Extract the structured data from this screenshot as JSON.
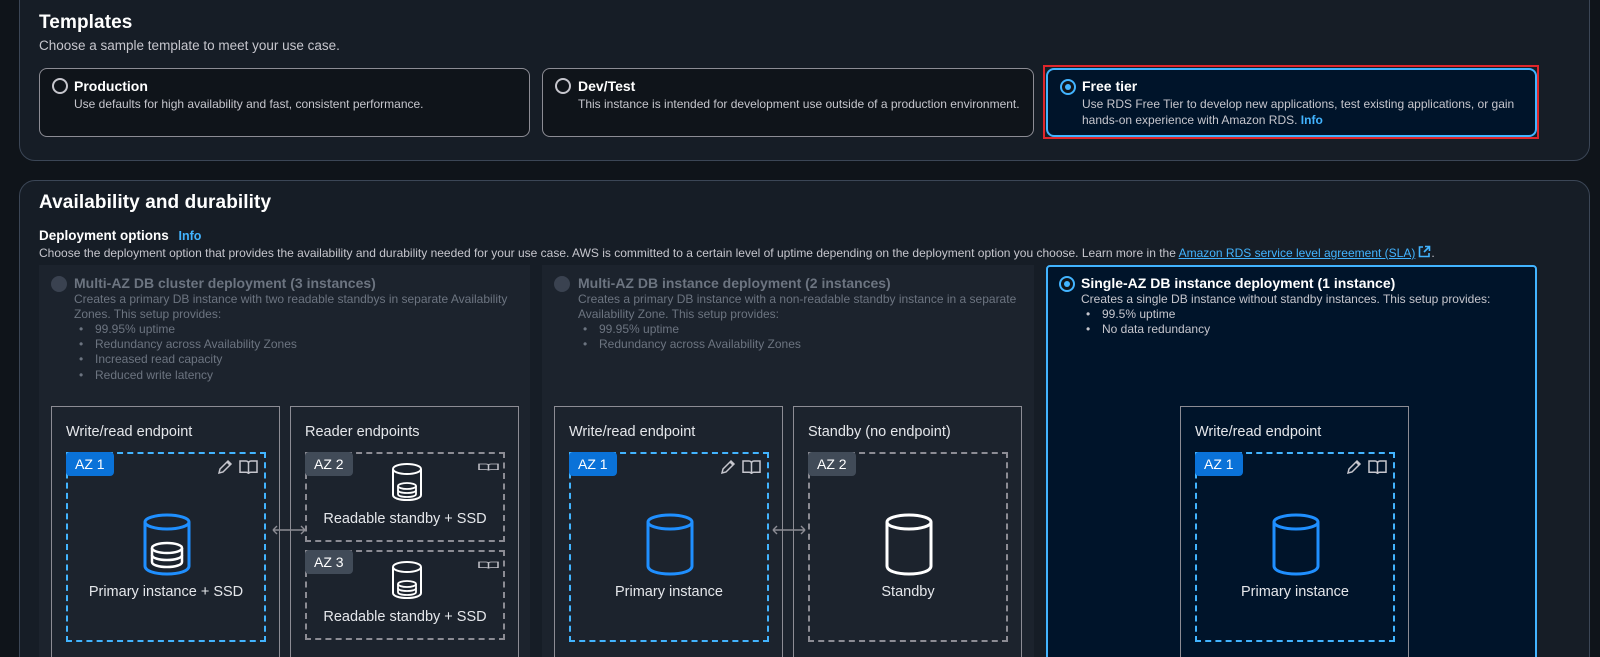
{
  "templates": {
    "title": "Templates",
    "subtitle": "Choose a sample template to meet your use case.",
    "options": [
      {
        "label": "Production",
        "desc": "Use defaults for high availability and fast, consistent performance.",
        "selected": false
      },
      {
        "label": "Dev/Test",
        "desc": "This instance is intended for development use outside of a production environment.",
        "selected": false
      },
      {
        "label": "Free tier",
        "desc": "Use RDS Free Tier to develop new applications, test existing applications, or gain hands-on experience with Amazon RDS.",
        "info": "Info",
        "selected": true
      }
    ]
  },
  "availability": {
    "title": "Availability and durability",
    "deployment_label": "Deployment options",
    "info": "Info",
    "desc": "Choose the deployment option that provides the availability and durability needed for your use case. AWS is committed to a certain level of uptime depending on the deployment option you choose. Learn more in the",
    "sla_link": "Amazon RDS service level agreement (SLA)",
    "desc_end": ".",
    "options": [
      {
        "label": "Multi-AZ DB cluster deployment (3 instances)",
        "desc": "Creates a primary DB instance with two readable standbys in separate Availability Zones. This setup provides:",
        "bullets": [
          "99.95% uptime",
          "Redundancy across Availability Zones",
          "Increased read capacity",
          "Reduced write latency"
        ],
        "selected": false,
        "boxes": [
          {
            "title": "Write/read endpoint",
            "azs": [
              {
                "tag": "AZ 1",
                "label": "Primary instance + SSD"
              }
            ]
          },
          {
            "title": "Reader endpoints",
            "azs": [
              {
                "tag": "AZ 2",
                "label": "Readable standby + SSD"
              },
              {
                "tag": "AZ 3",
                "label": "Readable standby + SSD"
              }
            ]
          }
        ]
      },
      {
        "label": "Multi-AZ DB instance deployment (2 instances)",
        "desc": "Creates a primary DB instance with a non-readable standby instance in a separate Availability Zone. This setup provides:",
        "bullets": [
          "99.95% uptime",
          "Redundancy across Availability Zones"
        ],
        "selected": false,
        "boxes": [
          {
            "title": "Write/read endpoint",
            "azs": [
              {
                "tag": "AZ 1",
                "label": "Primary instance"
              }
            ]
          },
          {
            "title": "Standby (no endpoint)",
            "azs": [
              {
                "tag": "AZ 2",
                "label": "Standby"
              }
            ]
          }
        ]
      },
      {
        "label": "Single-AZ DB instance deployment (1 instance)",
        "desc": "Creates a single DB instance without standby instances. This setup provides:",
        "bullets": [
          "99.5% uptime",
          "No data redundancy"
        ],
        "selected": true,
        "boxes": [
          {
            "title": "Write/read endpoint",
            "azs": [
              {
                "tag": "AZ 1",
                "label": "Primary instance"
              }
            ]
          }
        ]
      }
    ]
  },
  "colors": {
    "accent": "#42b4ff",
    "az_primary": "#0a72d8",
    "highlight": "#e0262b"
  },
  "icons": [
    "radio-button",
    "external-link-icon",
    "edit-pencil-icon",
    "book-icon",
    "database-icon",
    "bidirectional-arrow-icon"
  ]
}
